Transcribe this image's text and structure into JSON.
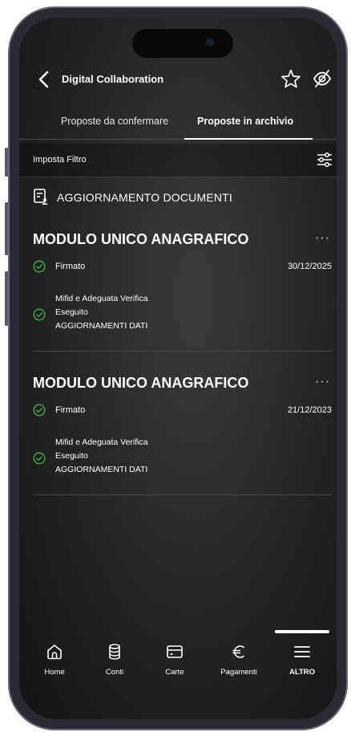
{
  "header": {
    "title": "Digital Collaboration"
  },
  "tabs": [
    {
      "label": "Proposte da confermare",
      "active": false
    },
    {
      "label": "Proposte in archivio",
      "active": true
    }
  ],
  "filter": {
    "label": "Imposta Filtro"
  },
  "section": {
    "title": "AGGIORNAMENTO DOCUMENTI"
  },
  "cards": [
    {
      "title": "MODULO UNICO ANAGRAFICO",
      "more": "···",
      "status": "Firmato",
      "date": "30/12/2025",
      "sub_title": "Mifid e Adeguata Verifica",
      "sub_status": "Eseguito",
      "sub_detail": "AGGIORNAMENTI DATI"
    },
    {
      "title": "MODULO UNICO ANAGRAFICO",
      "more": "···",
      "status": "Firmato",
      "date": "21/12/2023",
      "sub_title": "Mifid e Adeguata Verifica",
      "sub_status": "Eseguito",
      "sub_detail": "AGGIORNAMENTI DATI"
    }
  ],
  "bottom_nav": [
    {
      "label": "Home",
      "icon": "home-icon"
    },
    {
      "label": "Conti",
      "icon": "database-icon"
    },
    {
      "label": "Carte",
      "icon": "card-icon"
    },
    {
      "label": "Pagamenti",
      "icon": "euro-icon"
    },
    {
      "label": "ALTRO",
      "icon": "menu-icon",
      "active": true
    }
  ],
  "colors": {
    "background": "#242424",
    "text": "#ffffff",
    "success": "#3fb24a"
  }
}
